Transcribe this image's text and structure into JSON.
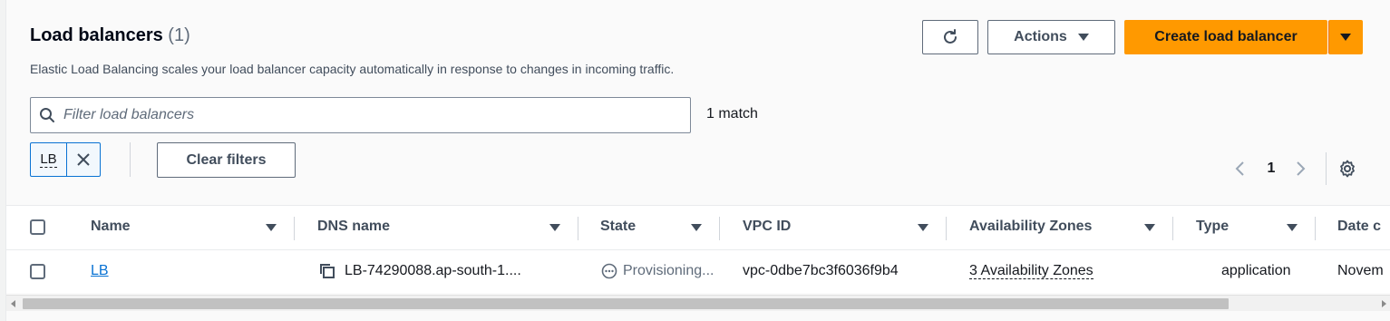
{
  "header": {
    "title": "Load balancers",
    "count": "(1)",
    "description": "Elastic Load Balancing scales your load balancer capacity automatically in response to changes in incoming traffic."
  },
  "toolbar": {
    "refresh_icon": "refresh-icon",
    "actions_label": "Actions",
    "create_label": "Create load balancer"
  },
  "filter": {
    "placeholder": "Filter load balancers",
    "value": "",
    "match_text": "1 match",
    "token_label": "LB",
    "clear_label": "Clear filters"
  },
  "pagination": {
    "current_page": "1"
  },
  "table": {
    "columns": [
      "Name",
      "DNS name",
      "State",
      "VPC ID",
      "Availability Zones",
      "Type",
      "Date c"
    ],
    "rows": [
      {
        "name": "LB",
        "dns_name": "LB-74290088.ap-south-1....",
        "state": "Provisioning...",
        "vpc_id": "vpc-0dbe7bc3f6036f9b4",
        "availability_zones": "3 Availability Zones",
        "type": "application",
        "date_created": "Novem"
      }
    ]
  },
  "colors": {
    "accent": "#ff9900",
    "link": "#0972d3",
    "text": "#16191f"
  }
}
